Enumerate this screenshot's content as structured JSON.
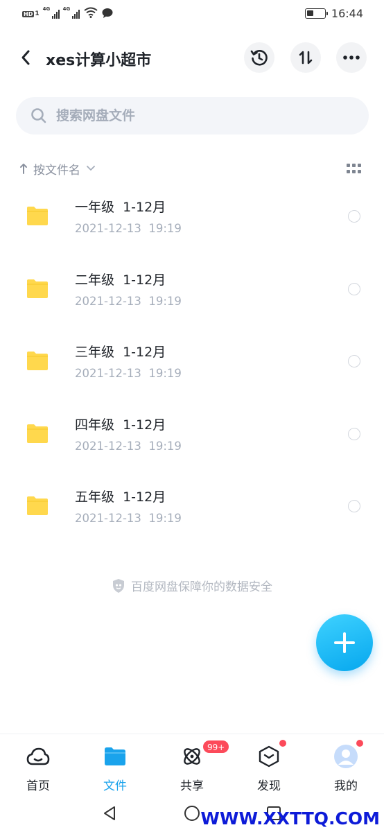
{
  "status_bar": {
    "time": "16:44",
    "hd": "HD",
    "sim": "1",
    "net1": "4G",
    "net2": "4G"
  },
  "header": {
    "title": "xes计算小超市"
  },
  "search": {
    "placeholder": "搜索网盘文件"
  },
  "sort": {
    "label": "按文件名"
  },
  "files": [
    {
      "name": "一年级  1-12月",
      "date": "2021-12-13  19:19"
    },
    {
      "name": "二年级  1-12月",
      "date": "2021-12-13  19:19"
    },
    {
      "name": "三年级  1-12月",
      "date": "2021-12-13  19:19"
    },
    {
      "name": "四年级  1-12月",
      "date": "2021-12-13  19:19"
    },
    {
      "name": "五年级  1-12月",
      "date": "2021-12-13  19:19"
    }
  ],
  "safety_text": "百度网盘保障你的数据安全",
  "nav": [
    {
      "label": "首页",
      "icon": "cloud-home-icon"
    },
    {
      "label": "文件",
      "icon": "folder-icon",
      "active": true
    },
    {
      "label": "共享",
      "icon": "atom-share-icon",
      "badge": "99+"
    },
    {
      "label": "发现",
      "icon": "cube-discover-icon"
    },
    {
      "label": "我的",
      "icon": "avatar-icon"
    }
  ],
  "watermark": "WWW.XXTTQ.COM",
  "colors": {
    "accent": "#1aa3ec",
    "folder": "#ffd84d",
    "badge": "#fc4a5a"
  }
}
